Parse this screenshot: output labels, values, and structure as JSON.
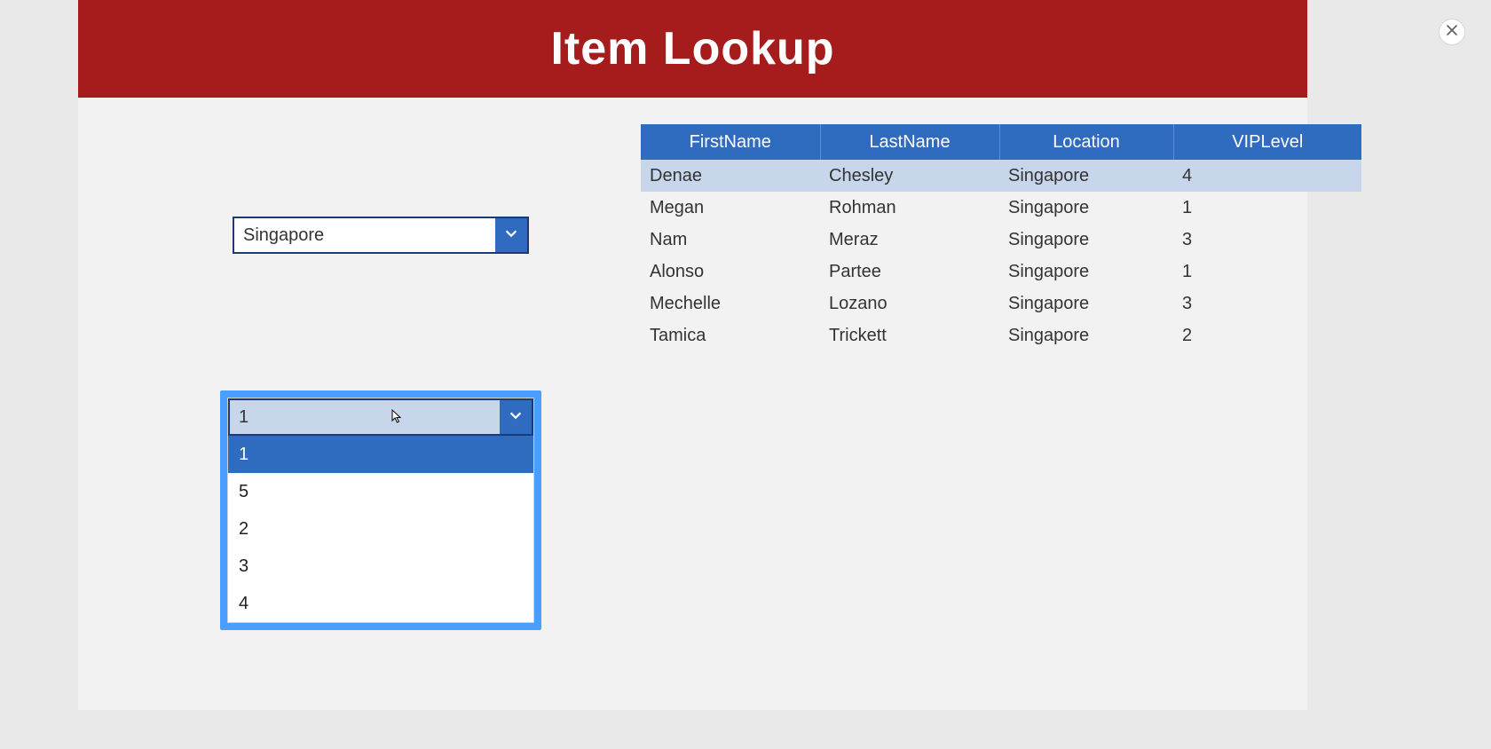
{
  "header": {
    "title": "Item Lookup"
  },
  "dropdown_location": {
    "selected": "Singapore"
  },
  "dropdown_vip": {
    "selected": "1",
    "options": [
      "1",
      "5",
      "2",
      "3",
      "4"
    ],
    "highlighted_index": 0
  },
  "table": {
    "columns": [
      "FirstName",
      "LastName",
      "Location",
      "VIPLevel"
    ],
    "selected_index": 0,
    "rows": [
      {
        "FirstName": "Denae",
        "LastName": "Chesley",
        "Location": "Singapore",
        "VIPLevel": "4"
      },
      {
        "FirstName": "Megan",
        "LastName": "Rohman",
        "Location": "Singapore",
        "VIPLevel": "1"
      },
      {
        "FirstName": "Nam",
        "LastName": "Meraz",
        "Location": "Singapore",
        "VIPLevel": "3"
      },
      {
        "FirstName": "Alonso",
        "LastName": "Partee",
        "Location": "Singapore",
        "VIPLevel": "1"
      },
      {
        "FirstName": "Mechelle",
        "LastName": "Lozano",
        "Location": "Singapore",
        "VIPLevel": "3"
      },
      {
        "FirstName": "Tamica",
        "LastName": "Trickett",
        "Location": "Singapore",
        "VIPLevel": "2"
      }
    ]
  }
}
